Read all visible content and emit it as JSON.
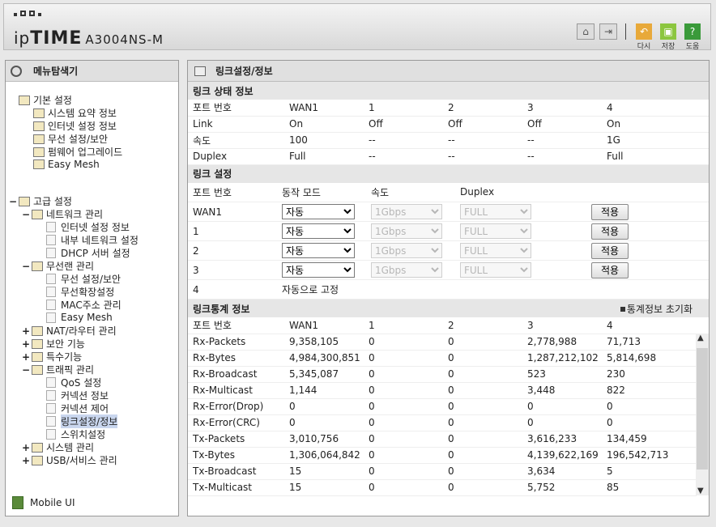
{
  "header": {
    "brand_a": "ip",
    "brand_b": "TIME",
    "model": "A3004NS-M",
    "btn_redo": "다시",
    "btn_save": "저장",
    "btn_help": "도움"
  },
  "sidebar": {
    "title": "메뉴탐색기",
    "mobile": "Mobile UI",
    "basic": {
      "label": "기본 설정",
      "items": [
        "시스템 요약 정보",
        "인터넷 설정 정보",
        "무선 설정/보안",
        "펌웨어 업그레이드",
        "Easy Mesh"
      ]
    },
    "adv": {
      "label": "고급 설정",
      "net": {
        "label": "네트워크 관리",
        "items": [
          "인터넷 설정 정보",
          "내부 네트워크 설정",
          "DHCP 서버 설정"
        ]
      },
      "wlan": {
        "label": "무선랜 관리",
        "items": [
          "무선 설정/보안",
          "무선확장설정",
          "MAC주소 관리",
          "Easy Mesh"
        ]
      },
      "nat": "NAT/라우터 관리",
      "sec": "보안 기능",
      "special": "특수기능",
      "traffic": {
        "label": "트래픽 관리",
        "items": [
          "QoS 설정",
          "커넥션 정보",
          "커넥션 제어",
          "링크설정/정보",
          "스위치설정"
        ]
      },
      "sys": "시스템 관리",
      "usb": "USB/서비스 관리"
    }
  },
  "main": {
    "title": "링크설정/정보",
    "status": {
      "title": "링크 상태 정보",
      "headers": [
        "포트 번호",
        "WAN1",
        "1",
        "2",
        "3",
        "4"
      ],
      "rows": [
        [
          "Link",
          "On",
          "Off",
          "Off",
          "Off",
          "On"
        ],
        [
          "속도",
          "100",
          "--",
          "--",
          "--",
          "1G"
        ],
        [
          "Duplex",
          "Full",
          "--",
          "--",
          "--",
          "Full"
        ]
      ]
    },
    "link": {
      "title": "링크 설정",
      "headers": [
        "포트 번호",
        "동작 모드",
        "속도",
        "Duplex"
      ],
      "mode": "자동",
      "speed": "1Gbps",
      "duplex": "FULL",
      "apply": "적용",
      "ports": [
        "WAN1",
        "1",
        "2",
        "3"
      ],
      "port4": "4",
      "port4_text": "자동으로 고정"
    },
    "stats": {
      "title": "링크통계 정보",
      "reset": "통계정보 초기화",
      "headers": [
        "포트 번호",
        "WAN1",
        "1",
        "2",
        "3",
        "4"
      ],
      "rows": [
        [
          "Rx-Packets",
          "9,358,105",
          "0",
          "0",
          "2,778,988",
          "71,713"
        ],
        [
          "Rx-Bytes",
          "4,984,300,851",
          "0",
          "0",
          "1,287,212,102",
          "5,814,698"
        ],
        [
          "Rx-Broadcast",
          "5,345,087",
          "0",
          "0",
          "523",
          "230"
        ],
        [
          "Rx-Multicast",
          "1,144",
          "0",
          "0",
          "3,448",
          "822"
        ],
        [
          "Rx-Error(Drop)",
          "0",
          "0",
          "0",
          "0",
          "0"
        ],
        [
          "Rx-Error(CRC)",
          "0",
          "0",
          "0",
          "0",
          "0"
        ],
        [
          "Tx-Packets",
          "3,010,756",
          "0",
          "0",
          "3,616,233",
          "134,459"
        ],
        [
          "Tx-Bytes",
          "1,306,064,842",
          "0",
          "0",
          "4,139,622,169",
          "196,542,713"
        ],
        [
          "Tx-Broadcast",
          "15",
          "0",
          "0",
          "3,634",
          "5"
        ],
        [
          "Tx-Multicast",
          "15",
          "0",
          "0",
          "5,752",
          "85"
        ]
      ]
    }
  }
}
